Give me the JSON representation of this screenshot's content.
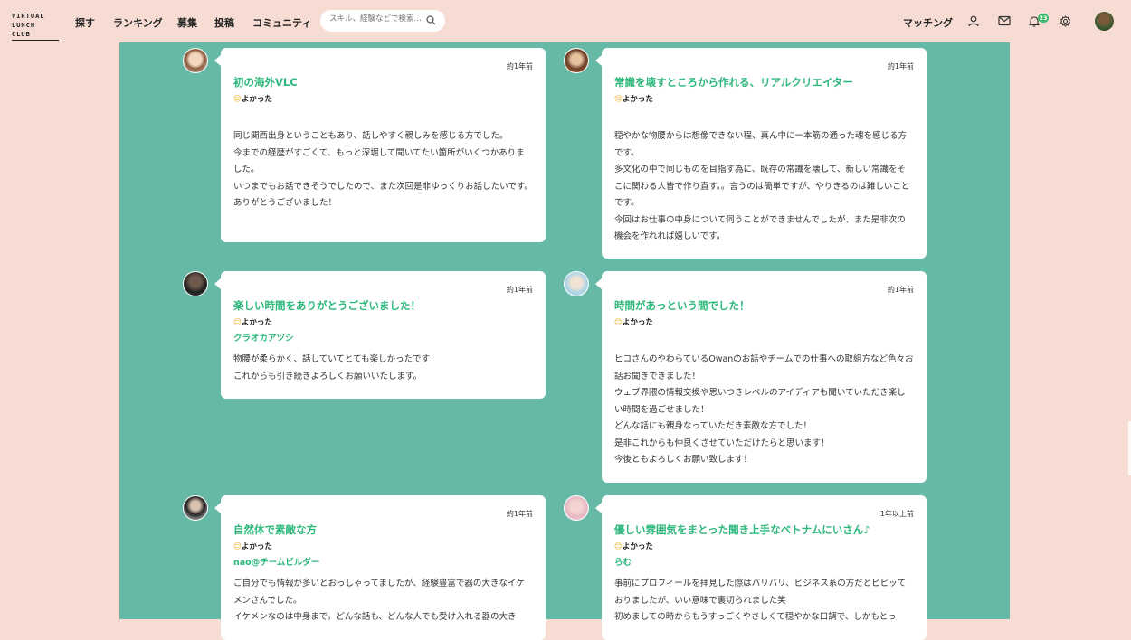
{
  "header": {
    "logo_line1": "VIRTUAL",
    "logo_line2": "LUNCH CLUB",
    "nav": [
      "探す",
      "ランキング",
      "募集",
      "投稿",
      "コミュニティ"
    ],
    "search_placeholder": "スキル、経験などで検索…",
    "matching_label": "マッチング",
    "notification_count": "23"
  },
  "reviews": [
    {
      "time": "約1年前",
      "title": "初の海外VLC",
      "reaction_emoji": "😊",
      "reaction": "よかった",
      "nick": "",
      "body": "同じ関西出身ということもあり、話しやすく親しみを感じる方でした。\n今までの経歴がすごくて、もっと深堀して聞いてたい箇所がいくつかありました。\nいつまでもお話できそうでしたので、また次回是非ゆっくりお話したいです。\nありがとうございました！"
    },
    {
      "time": "約1年前",
      "title": "常識を壊すところから作れる、リアルクリエイター",
      "reaction_emoji": "😊",
      "reaction": "よかった",
      "nick": "",
      "body": "穏やかな物腰からは想像できない程、真ん中に一本筋の通った魂を感じる方です。\n多文化の中で同じものを目指す為に、既存の常識を壊して、新しい常識をそこに関わる人皆で作り直す。。言うのは簡単ですが、やりきるのは難しいことです。\n今回はお仕事の中身について伺うことができませんでしたが、また是非次の機会を作れれば嬉しいです。"
    },
    {
      "time": "約1年前",
      "title": "楽しい時間をありがとうございました！",
      "reaction_emoji": "😊",
      "reaction": "よかった",
      "nick": "クラオカアツシ",
      "body": "物腰が柔らかく、話していてとても楽しかったです！\nこれからも引き続きよろしくお願いいたします。"
    },
    {
      "time": "約1年前",
      "title": "時間があっという間でした！",
      "reaction_emoji": "😊",
      "reaction": "よかった",
      "nick": "",
      "body": "ヒコさんのやわらているOwanのお話やチームでの仕事への取組方など色々お話お聞きできました！\nウェブ界隈の情報交換や思いつきレベルのアイディアも聞いていただき楽しい時間を過ごせました！\nどんな話にも親身なっていただき素敵な方でした！\n是非これからも仲良くさせていただけたらと思います！\n今後ともよろしくお願い致します！"
    },
    {
      "time": "約1年前",
      "title": "自然体で素敵な方",
      "reaction_emoji": "😊",
      "reaction": "よかった",
      "nick": "nao@チームビルダー",
      "body": "ご自分でも情報が多いとおっしゃってましたが、経験豊富で器の大きなイケメンさんでした。\nイケメンなのは中身まで。どんな話も、どんな人でも受け入れる器の大き"
    },
    {
      "time": "1年以上前",
      "title": "優しい雰囲気をまとった聞き上手なベトナムにいさん♪",
      "reaction_emoji": "😊",
      "reaction": "よかった",
      "nick": "らむ",
      "body": "事前にプロフィールを拝見した際はバリバリ、ビジネス系の方だとビビッておりましたが、いい意味で裏切られました笑\n初めましての時からもうすっごくやさしくて穏やかな口調で、しかもとっ"
    }
  ]
}
